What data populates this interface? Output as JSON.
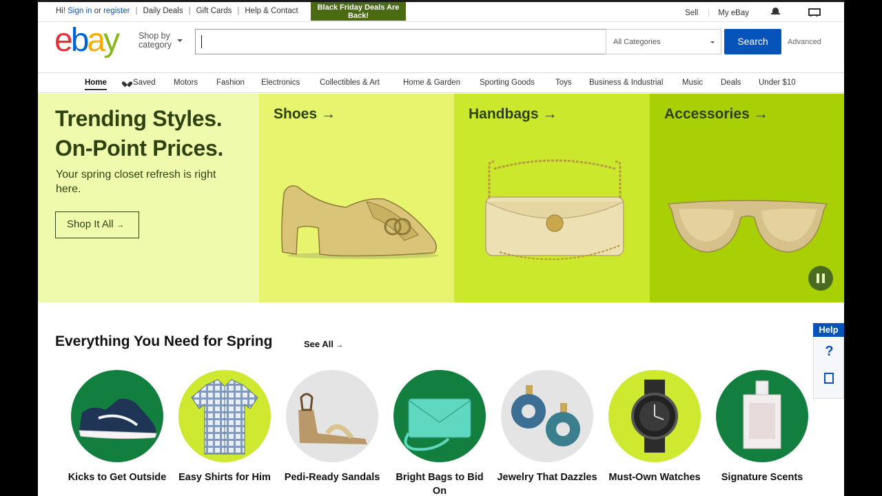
{
  "topbar": {
    "greeting": "Hi!",
    "sign_in": "Sign in",
    "or": "or",
    "register": "register",
    "links": [
      "Daily Deals",
      "Gift Cards",
      "Help & Contact"
    ],
    "promo": "Black Friday Deals Are Back!",
    "sell": "Sell",
    "my_ebay": "My eBay",
    "bell_icon": "bell-icon",
    "cart_icon": "cart-icon"
  },
  "header": {
    "logo": {
      "e": "e",
      "b": "b",
      "a": "a",
      "y": "y"
    },
    "shop_by": "Shop by category",
    "search_value": "",
    "category_select": "All Categories",
    "search_button": "Search",
    "advanced": "Advanced"
  },
  "nav": {
    "items": [
      "Home",
      "Saved",
      "Motors",
      "Fashion",
      "Electronics",
      "Collectibles & Art",
      "Home & Garden",
      "Sporting Goods",
      "Toys",
      "Business & Industrial",
      "Music",
      "Deals",
      "Under $10"
    ]
  },
  "hero": {
    "title": "Trending Styles. On-Point Prices.",
    "subtitle": "Your spring closet refresh is right here.",
    "cta": "Shop It All",
    "panels": [
      {
        "title": "Shoes",
        "image": "gold-loafer-shoe"
      },
      {
        "title": "Handbags",
        "image": "cream-chain-handbag"
      },
      {
        "title": "Accessories",
        "image": "gold-mirrored-sunglasses"
      }
    ],
    "arrow": "→"
  },
  "section": {
    "title": "Everything You Need for Spring",
    "see_all": "See All",
    "categories": [
      {
        "label": "Kicks to Get Outside",
        "image": "sneaker"
      },
      {
        "label": "Easy Shirts for Him",
        "image": "plaid-shirt"
      },
      {
        "label": "Pedi-Ready Sandals",
        "image": "wedge-sandal"
      },
      {
        "label": "Bright Bags to Bid On",
        "image": "teal-clutch"
      },
      {
        "label": "Jewelry That Dazzles",
        "image": "abalone-earrings"
      },
      {
        "label": "Must-Own Watches",
        "image": "black-watch"
      },
      {
        "label": "Signature Scents",
        "image": "perfume-bottle"
      }
    ]
  },
  "help": {
    "tab": "Help",
    "question": "?"
  },
  "colors": {
    "brand_blue": "#0654ba",
    "hero_dark_green": "#2e4111",
    "accent_green": "#137f3e"
  }
}
